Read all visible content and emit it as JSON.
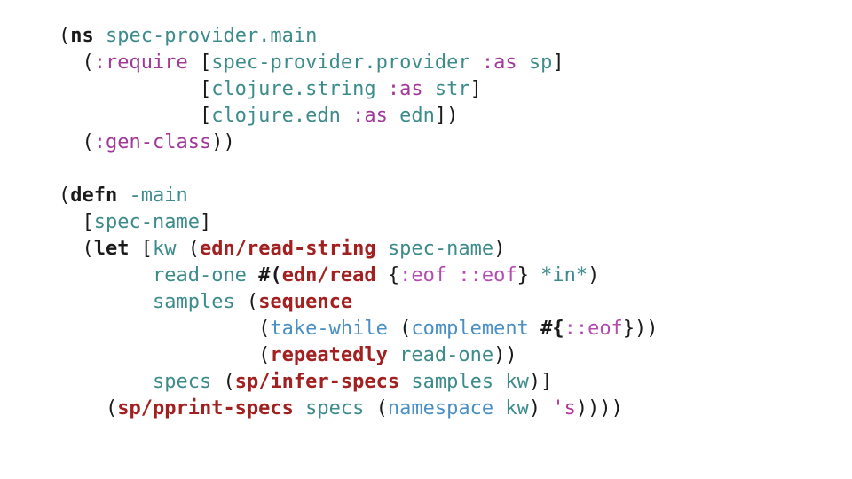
{
  "editor": {
    "background": "#ffffff",
    "font_size_px": 22,
    "line_height_px": 30
  },
  "colors": {
    "punctuation": "#1a1a1a",
    "special_form": "#1a1a1a",
    "symbol": "#3d8b8b",
    "keyword": "#a0399a",
    "keyword_data": "#b44cb0",
    "function": "#a32020",
    "core_function": "#4a90c4",
    "quoted_symbol": "#b0389e"
  },
  "code": {
    "language": "clojure",
    "full_text": "(ns spec-provider.main\n  (:require [spec-provider.provider :as sp]\n            [clojure.string :as str]\n            [clojure.edn :as edn])\n  (:gen-class))\n\n(defn -main\n  [spec-name]\n  (let [kw (edn/read-string spec-name)\n        read-one #(edn/read {:eof ::eof} *in*)\n        samples (sequence\n                 (take-while (complement #{::eof}))\n                 (repeatedly read-one))\n        specs (sp/infer-specs samples kw)]\n    (sp/pprint-specs specs (namespace kw) 's))))",
    "lines": [
      {
        "index": 1,
        "tokens": [
          {
            "t": "(",
            "c": "punct"
          },
          {
            "t": "ns",
            "c": "special"
          },
          {
            "t": " ",
            "c": "punct"
          },
          {
            "t": "spec-provider.main",
            "c": "sym"
          }
        ]
      },
      {
        "index": 2,
        "tokens": [
          {
            "t": "  (",
            "c": "punct"
          },
          {
            "t": ":require",
            "c": "kw"
          },
          {
            "t": " [",
            "c": "punct"
          },
          {
            "t": "spec-provider.provider",
            "c": "sym"
          },
          {
            "t": " ",
            "c": "punct"
          },
          {
            "t": ":as",
            "c": "kw"
          },
          {
            "t": " ",
            "c": "punct"
          },
          {
            "t": "sp",
            "c": "sym"
          },
          {
            "t": "]",
            "c": "punct"
          }
        ]
      },
      {
        "index": 3,
        "tokens": [
          {
            "t": "            [",
            "c": "punct"
          },
          {
            "t": "clojure.string",
            "c": "sym"
          },
          {
            "t": " ",
            "c": "punct"
          },
          {
            "t": ":as",
            "c": "kw"
          },
          {
            "t": " ",
            "c": "punct"
          },
          {
            "t": "str",
            "c": "sym"
          },
          {
            "t": "]",
            "c": "punct"
          }
        ]
      },
      {
        "index": 4,
        "tokens": [
          {
            "t": "            [",
            "c": "punct"
          },
          {
            "t": "clojure.edn",
            "c": "sym"
          },
          {
            "t": " ",
            "c": "punct"
          },
          {
            "t": ":as",
            "c": "kw"
          },
          {
            "t": " ",
            "c": "punct"
          },
          {
            "t": "edn",
            "c": "sym"
          },
          {
            "t": "])",
            "c": "punct"
          }
        ]
      },
      {
        "index": 5,
        "tokens": [
          {
            "t": "  (",
            "c": "punct"
          },
          {
            "t": ":gen-class",
            "c": "kw"
          },
          {
            "t": "))",
            "c": "punct"
          }
        ]
      },
      {
        "index": 6,
        "tokens": []
      },
      {
        "index": 7,
        "tokens": [
          {
            "t": "(",
            "c": "punct"
          },
          {
            "t": "defn",
            "c": "special"
          },
          {
            "t": " ",
            "c": "punct"
          },
          {
            "t": "-main",
            "c": "sym"
          }
        ]
      },
      {
        "index": 8,
        "tokens": [
          {
            "t": "  [",
            "c": "punct"
          },
          {
            "t": "spec-name",
            "c": "sym"
          },
          {
            "t": "]",
            "c": "punct"
          }
        ]
      },
      {
        "index": 9,
        "tokens": [
          {
            "t": "  (",
            "c": "punct"
          },
          {
            "t": "let",
            "c": "special"
          },
          {
            "t": " [",
            "c": "punct"
          },
          {
            "t": "kw",
            "c": "sym"
          },
          {
            "t": " (",
            "c": "punct"
          },
          {
            "t": "edn/read-string",
            "c": "fn"
          },
          {
            "t": " ",
            "c": "punct"
          },
          {
            "t": "spec-name",
            "c": "sym"
          },
          {
            "t": ")",
            "c": "punct"
          }
        ]
      },
      {
        "index": 10,
        "tokens": [
          {
            "t": "        ",
            "c": "punct"
          },
          {
            "t": "read-one",
            "c": "sym"
          },
          {
            "t": " ",
            "c": "punct"
          },
          {
            "t": "#(",
            "c": "reader"
          },
          {
            "t": "edn/read",
            "c": "fn"
          },
          {
            "t": " {",
            "c": "punct"
          },
          {
            "t": ":eof",
            "c": "kwdata"
          },
          {
            "t": " ",
            "c": "punct"
          },
          {
            "t": "::eof",
            "c": "kwdata"
          },
          {
            "t": "} ",
            "c": "punct"
          },
          {
            "t": "*in*",
            "c": "sym"
          },
          {
            "t": ")",
            "c": "punct"
          }
        ]
      },
      {
        "index": 11,
        "tokens": [
          {
            "t": "        ",
            "c": "punct"
          },
          {
            "t": "samples",
            "c": "sym"
          },
          {
            "t": " (",
            "c": "punct"
          },
          {
            "t": "sequence",
            "c": "fn"
          }
        ]
      },
      {
        "index": 12,
        "tokens": [
          {
            "t": "                 (",
            "c": "punct"
          },
          {
            "t": "take-while",
            "c": "core"
          },
          {
            "t": " (",
            "c": "punct"
          },
          {
            "t": "complement",
            "c": "core"
          },
          {
            "t": " ",
            "c": "punct"
          },
          {
            "t": "#{",
            "c": "reader"
          },
          {
            "t": "::eof",
            "c": "kwdata"
          },
          {
            "t": "}))",
            "c": "punct"
          }
        ]
      },
      {
        "index": 13,
        "tokens": [
          {
            "t": "                 (",
            "c": "punct"
          },
          {
            "t": "repeatedly",
            "c": "fn"
          },
          {
            "t": " ",
            "c": "punct"
          },
          {
            "t": "read-one",
            "c": "sym"
          },
          {
            "t": "))",
            "c": "punct"
          }
        ]
      },
      {
        "index": 14,
        "tokens": [
          {
            "t": "        ",
            "c": "punct"
          },
          {
            "t": "specs",
            "c": "sym"
          },
          {
            "t": " (",
            "c": "punct"
          },
          {
            "t": "sp/infer-specs",
            "c": "fn"
          },
          {
            "t": " ",
            "c": "punct"
          },
          {
            "t": "samples",
            "c": "sym"
          },
          {
            "t": " ",
            "c": "punct"
          },
          {
            "t": "kw",
            "c": "sym"
          },
          {
            "t": ")]",
            "c": "punct"
          }
        ]
      },
      {
        "index": 15,
        "tokens": [
          {
            "t": "    (",
            "c": "punct"
          },
          {
            "t": "sp/pprint-specs",
            "c": "fn"
          },
          {
            "t": " ",
            "c": "punct"
          },
          {
            "t": "specs",
            "c": "sym"
          },
          {
            "t": " (",
            "c": "punct"
          },
          {
            "t": "namespace",
            "c": "core"
          },
          {
            "t": " ",
            "c": "punct"
          },
          {
            "t": "kw",
            "c": "sym"
          },
          {
            "t": ") ",
            "c": "punct"
          },
          {
            "t": "'s",
            "c": "quoted"
          },
          {
            "t": "))))",
            "c": "punct"
          }
        ]
      }
    ]
  }
}
